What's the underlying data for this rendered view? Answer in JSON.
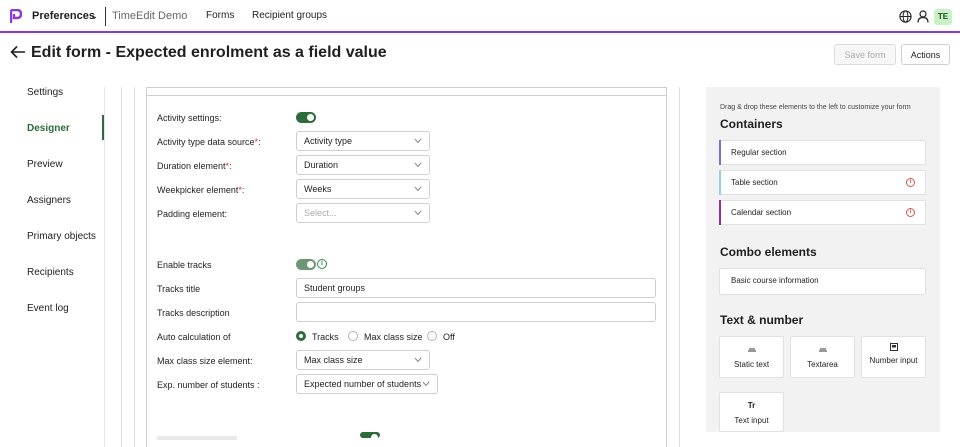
{
  "topbar": {
    "app_name": "Preferences",
    "org_name": "TimeEdit Demo",
    "nav": [
      "Forms",
      "Recipient groups"
    ],
    "avatar_initials": "TE",
    "accent": "#8a3ad6"
  },
  "header": {
    "title": "Edit form - Expected enrolment as a field value",
    "save_label": "Save form",
    "actions_label": "Actions"
  },
  "sidebar": {
    "items": [
      "Settings",
      "Designer",
      "Preview",
      "Assigners",
      "Primary objects",
      "Recipients",
      "Event log"
    ],
    "active": "Designer"
  },
  "form": {
    "activity_settings_label": "Activity settings:",
    "activity_settings_on": true,
    "activity_type_label": "Activity type data source",
    "activity_type_value": "Activity type",
    "duration_label": "Duration element",
    "duration_value": "Duration",
    "weekpicker_label": "Weekpicker element",
    "weekpicker_value": "Weeks",
    "padding_label": "Padding element:",
    "padding_placeholder": "Select...",
    "enable_tracks_label": "Enable tracks",
    "enable_tracks_on": true,
    "tracks_title_label": "Tracks title",
    "tracks_title_value": "Student groups",
    "tracks_description_label": "Tracks description",
    "tracks_description_value": "",
    "auto_calc_label": "Auto calculation of",
    "auto_calc_options": [
      "Tracks",
      "Max class size",
      "Off"
    ],
    "auto_calc_selected": "Tracks",
    "max_class_label": "Max class size element:",
    "max_class_value": "Max class size",
    "exp_students_label": "Exp. number of students :",
    "exp_students_value": "Expected number of students",
    "required_mark": "*",
    "label_suffix": ":"
  },
  "palette": {
    "hint": "Drag & drop these elements to the left to customize your form",
    "containers_title": "Containers",
    "containers": [
      {
        "label": "Regular section",
        "color": "#7b6fd6"
      },
      {
        "label": "Table section",
        "color": "#8fd3dc"
      },
      {
        "label": "Calendar section",
        "color": "#8b2fa8"
      }
    ],
    "combo_title": "Combo elements",
    "combo": [
      "Basic course information"
    ],
    "text_title": "Text & number",
    "text_tiles": [
      {
        "icon": "static-text-icon",
        "label": "Static text"
      },
      {
        "icon": "textarea-icon",
        "label": "Textarea"
      },
      {
        "icon": "number-input-icon",
        "label": "Number input"
      },
      {
        "icon": "text-input-icon",
        "glyph": "Tr",
        "label": "Text input"
      }
    ]
  }
}
